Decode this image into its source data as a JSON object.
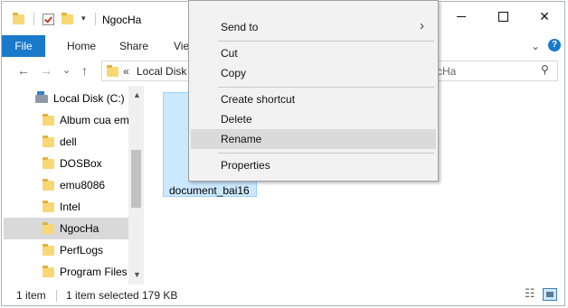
{
  "window": {
    "title": "NgocHa",
    "quick_access_dropdown": "▾",
    "controls": {
      "minimize": "",
      "maximize": "",
      "close": "✕"
    }
  },
  "ribbon": {
    "tabs": [
      "File",
      "Home",
      "Share",
      "View"
    ],
    "expand_chevron": "⌄",
    "help_label": "?"
  },
  "navigation": {
    "back": "←",
    "forward": "→",
    "recent": "⌄",
    "up": "↑",
    "breadcrumb_overflow": "«",
    "address_visible_left": "Local Disk (",
    "address_visible_right": "cHa",
    "search_icon": "⚲"
  },
  "tree": {
    "items": [
      {
        "label": "Local Disk (C:)",
        "icon": "drive-icon"
      },
      {
        "label": "Album cua em",
        "icon": "folder-icon"
      },
      {
        "label": "dell",
        "icon": "folder-icon"
      },
      {
        "label": "DOSBox",
        "icon": "folder-icon"
      },
      {
        "label": "emu8086",
        "icon": "folder-icon"
      },
      {
        "label": "Intel",
        "icon": "folder-icon"
      },
      {
        "label": "NgocHa",
        "icon": "folder-icon",
        "selected": true
      },
      {
        "label": "PerfLogs",
        "icon": "folder-icon"
      },
      {
        "label": "Program Files",
        "icon": "folder-icon"
      }
    ],
    "scroll_up": "▲",
    "scroll_down": "▼"
  },
  "content": {
    "file_name": "document_bai16"
  },
  "status_bar": {
    "item_count": "1 item",
    "selection": "1 item selected",
    "size": "179 KB"
  },
  "context_menu": {
    "items": [
      {
        "label": "Send to",
        "submenu": "›"
      },
      {
        "label": "Cut"
      },
      {
        "label": "Copy"
      },
      {
        "label": "Create shortcut"
      },
      {
        "label": "Delete"
      },
      {
        "label": "Rename",
        "highlighted": true
      },
      {
        "label": "Properties"
      }
    ]
  },
  "colors": {
    "file_tab": "#1979ca",
    "selection": "#cce8ff",
    "folder": "#f8d775",
    "menu_hover": "#dadada"
  }
}
